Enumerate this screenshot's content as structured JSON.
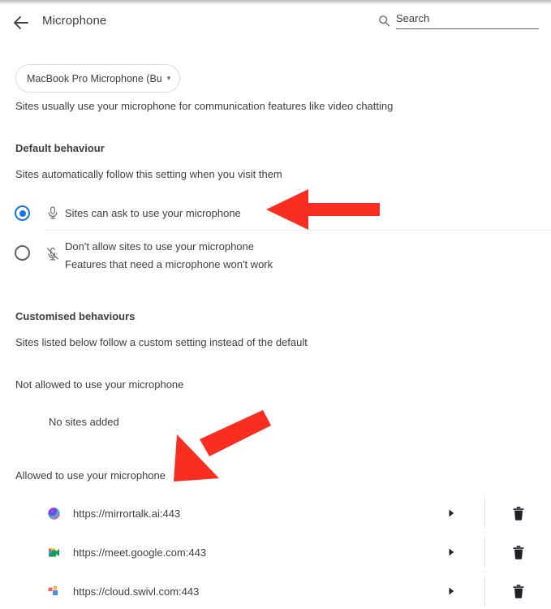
{
  "header": {
    "back_icon": "back-arrow-icon",
    "title": "Microphone",
    "search_icon": "search-icon",
    "search_placeholder": "Search",
    "search_value": ""
  },
  "device": {
    "selected": "MacBook Pro Microphone (Bu",
    "caret": "▾",
    "description": "Sites usually use your microphone for communication features like video chatting"
  },
  "default_behaviour": {
    "title": "Default behaviour",
    "subtitle": "Sites automatically follow this setting when you visit them",
    "options": [
      {
        "id": "ask",
        "icon": "microphone-icon",
        "label": "Sites can ask to use your microphone",
        "sublabel": "",
        "selected": true
      },
      {
        "id": "block",
        "icon": "microphone-muted-icon",
        "label": "Don't allow sites to use your microphone",
        "sublabel": "Features that need a microphone won't work",
        "selected": false
      }
    ]
  },
  "customised_behaviours": {
    "title": "Customised behaviours",
    "subtitle": "Sites listed below follow a custom setting instead of the default",
    "blocked": {
      "heading": "Not allowed to use your microphone",
      "empty_message": "No sites added",
      "sites": []
    },
    "allowed": {
      "heading": "Allowed to use your microphone",
      "sites": [
        {
          "url": "https://mirrortalk.ai:443",
          "favicon": "mirrortalk-gradient-sphere-icon",
          "chevron_icon": "chevron-right-icon",
          "delete_icon": "trash-icon"
        },
        {
          "url": "https://meet.google.com:443",
          "favicon": "google-meet-icon",
          "chevron_icon": "chevron-right-icon",
          "delete_icon": "trash-icon"
        },
        {
          "url": "https://cloud.swivl.com:443",
          "favicon": "swivl-squares-icon",
          "chevron_icon": "chevron-right-icon",
          "delete_icon": "trash-icon"
        }
      ]
    }
  },
  "annotations": [
    {
      "name": "arrow-pointing-to-ask-option",
      "direction": "left",
      "color": "#fa2d21"
    },
    {
      "name": "arrow-pointing-to-allowed-heading",
      "direction": "down-left",
      "color": "#fa2d21"
    }
  ],
  "colors": {
    "accent": "#1a73e8",
    "text": "#3c4043",
    "muted": "#5f6368",
    "divider": "#dadce0",
    "annotation_red": "#fa2d21"
  }
}
